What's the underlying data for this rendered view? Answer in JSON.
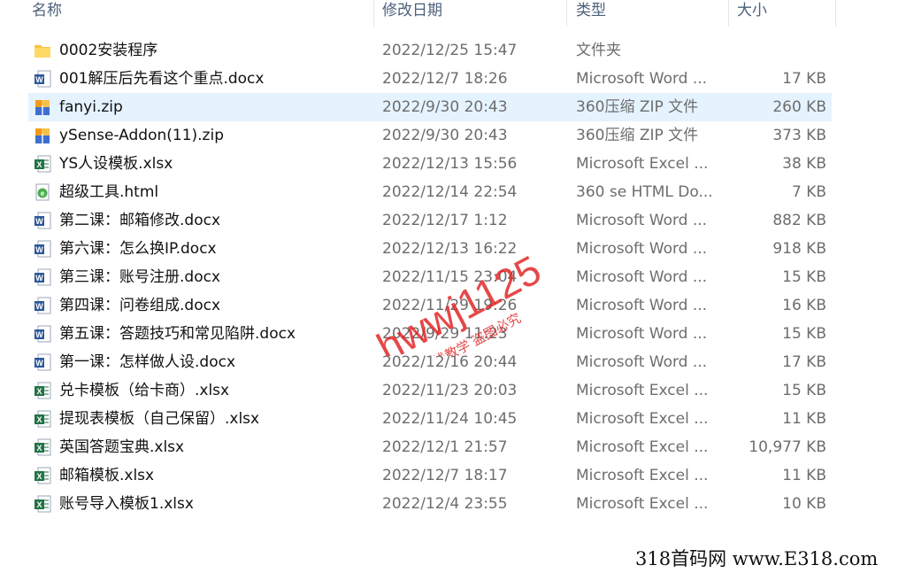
{
  "columns": {
    "name": "名称",
    "modified": "修改日期",
    "type": "类型",
    "size": "大小"
  },
  "files": [
    {
      "name": "0002安装程序",
      "modified": "2022/12/25 15:47",
      "type": "文件夹",
      "size": "",
      "icon": "folder-icon"
    },
    {
      "name": "001解压后先看这个重点.docx",
      "modified": "2022/12/7 18:26",
      "type": "Microsoft Word ...",
      "size": "17 KB",
      "icon": "word-icon"
    },
    {
      "name": "fanyi.zip",
      "modified": "2022/9/30 20:43",
      "type": "360压缩 ZIP 文件",
      "size": "260 KB",
      "icon": "zip-icon",
      "selected": true
    },
    {
      "name": "ySense-Addon(11).zip",
      "modified": "2022/9/30 20:43",
      "type": "360压缩 ZIP 文件",
      "size": "373 KB",
      "icon": "zip-icon"
    },
    {
      "name": "YS人设模板.xlsx",
      "modified": "2022/12/13 15:56",
      "type": "Microsoft Excel ...",
      "size": "38 KB",
      "icon": "excel-icon"
    },
    {
      "name": "超级工具.html",
      "modified": "2022/12/14 22:54",
      "type": "360 se HTML Do...",
      "size": "7 KB",
      "icon": "html-icon"
    },
    {
      "name": "第二课：邮箱修改.docx",
      "modified": "2022/12/17 1:12",
      "type": "Microsoft Word ...",
      "size": "882 KB",
      "icon": "word-icon"
    },
    {
      "name": "第六课：怎么换IP.docx",
      "modified": "2022/12/13 16:22",
      "type": "Microsoft Word ...",
      "size": "918 KB",
      "icon": "word-icon"
    },
    {
      "name": "第三课：账号注册.docx",
      "modified": "2022/11/15 23:04",
      "type": "Microsoft Word ...",
      "size": "15 KB",
      "icon": "word-icon"
    },
    {
      "name": "第四课：问卷组成.docx",
      "modified": "2022/11/29 19:26",
      "type": "Microsoft Word ...",
      "size": "16 KB",
      "icon": "word-icon"
    },
    {
      "name": "第五课：答题技巧和常见陷阱.docx",
      "modified": "2022/9/29 11:23",
      "type": "Microsoft Word ...",
      "size": "15 KB",
      "icon": "word-icon"
    },
    {
      "name": "第一课：怎样做人设.docx",
      "modified": "2022/12/16 20:44",
      "type": "Microsoft Word ...",
      "size": "17 KB",
      "icon": "word-icon"
    },
    {
      "name": "兑卡模板（给卡商）.xlsx",
      "modified": "2022/11/23 20:03",
      "type": "Microsoft Excel ...",
      "size": "15 KB",
      "icon": "excel-icon"
    },
    {
      "name": "提现表模板（自己保留）.xlsx",
      "modified": "2022/11/24 10:45",
      "type": "Microsoft Excel ...",
      "size": "11 KB",
      "icon": "excel-icon"
    },
    {
      "name": "英国答题宝典.xlsx",
      "modified": "2022/12/1 21:57",
      "type": "Microsoft Excel ...",
      "size": "10,977 KB",
      "icon": "excel-icon"
    },
    {
      "name": "邮箱模板.xlsx",
      "modified": "2022/12/7 18:17",
      "type": "Microsoft Excel ...",
      "size": "11 KB",
      "icon": "excel-icon"
    },
    {
      "name": "账号导入模板1.xlsx",
      "modified": "2022/12/4 23:55",
      "type": "Microsoft Excel ...",
      "size": "10 KB",
      "icon": "excel-icon"
    }
  ],
  "watermark": {
    "main": "hwwj1125",
    "sub": "一线教学 盗图必究",
    "color": "#e02020"
  },
  "footer": "318首码网 www.E318.com",
  "colors": {
    "selection": "#e5f3ff",
    "header_text": "#4c607a",
    "folder": "#f4c342",
    "word": "#2b579a",
    "excel": "#217346",
    "zip_blue": "#3d6fd1",
    "zip_orange": "#f19a1a"
  }
}
